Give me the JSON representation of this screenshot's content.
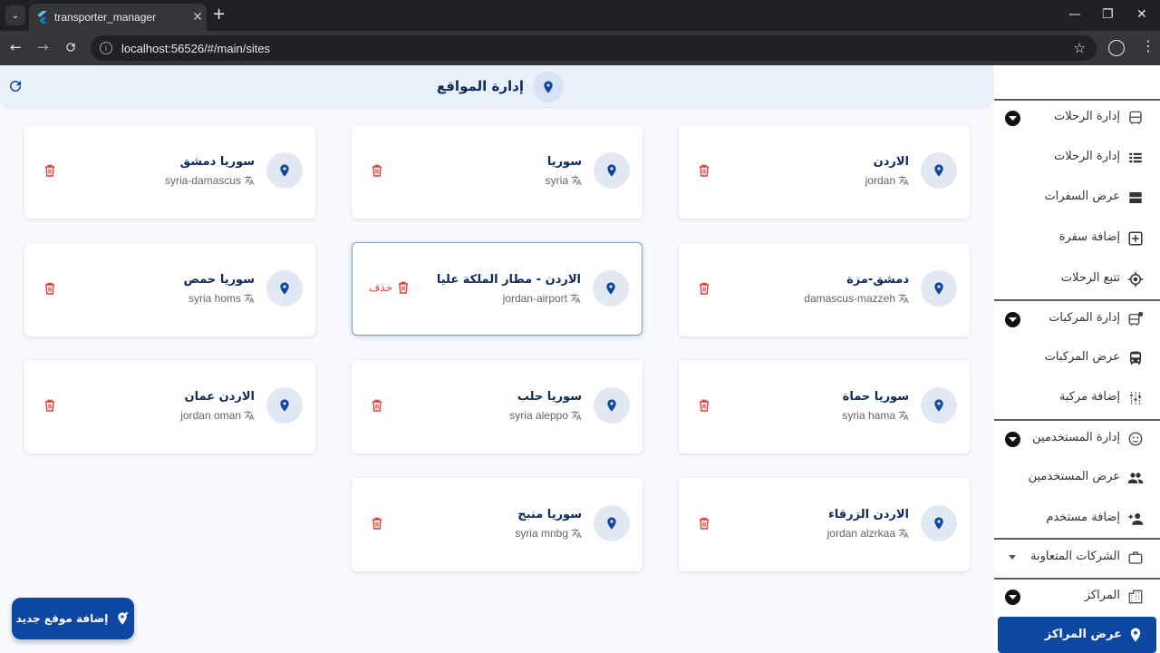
{
  "browser": {
    "tab_title": "transporter_manager",
    "url": "localhost:56526/#/main/sites"
  },
  "header": {
    "title": "إدارة المواقع"
  },
  "sites": [
    {
      "name": "الاردن",
      "slug": "jordan"
    },
    {
      "name": "سوريا",
      "slug": "syria"
    },
    {
      "name": "سوريا دمشق",
      "slug": "syria-damascus"
    },
    {
      "name": "دمشق-مزة",
      "slug": "damascus-mazzeh"
    },
    {
      "name": "الاردن - مطار الملكة عليا",
      "slug": "jordan-airport",
      "delete_label": "حذف"
    },
    {
      "name": "سوريا حمص",
      "slug": "syria homs"
    },
    {
      "name": "سوريا حماة",
      "slug": "syria hama"
    },
    {
      "name": "سوريا حلب",
      "slug": "syria aleppo"
    },
    {
      "name": "الاردن عمان",
      "slug": "jordan oman"
    },
    {
      "name": "الاردن الزرقاء",
      "slug": "jordan alzrkaa"
    },
    {
      "name": "سوريا منبج",
      "slug": "syria mnbg"
    }
  ],
  "fab": {
    "label": "إضافة موقع جديد"
  },
  "sidebar": {
    "items": [
      {
        "label": "إدارة الرحلات",
        "icon": "bus-icon"
      },
      {
        "label": "إدارة الرحلات",
        "icon": "list-icon"
      },
      {
        "label": "عرض السفرات",
        "icon": "storage-icon"
      },
      {
        "label": "إضافة سفرة",
        "icon": "add-box-icon"
      },
      {
        "label": "تتبع الرحلات",
        "icon": "gps-icon"
      },
      {
        "label": "إدارة المركبات",
        "icon": "bus-alert-icon"
      },
      {
        "label": "عرض المركبات",
        "icon": "bus-icon"
      },
      {
        "label": "إضافة مركبة",
        "icon": "tune-icon"
      },
      {
        "label": "إدارة المستخدمين",
        "icon": "face-icon"
      },
      {
        "label": "عرض المستخدمين",
        "icon": "people-icon"
      },
      {
        "label": "إضافة مستخدم",
        "icon": "person-add-icon"
      },
      {
        "label": "الشركات المتعاونة",
        "icon": "briefcase-icon"
      },
      {
        "label": "المراكز",
        "icon": "building-icon"
      },
      {
        "label": "عرض المراكز",
        "icon": "location-pin-icon"
      }
    ]
  }
}
